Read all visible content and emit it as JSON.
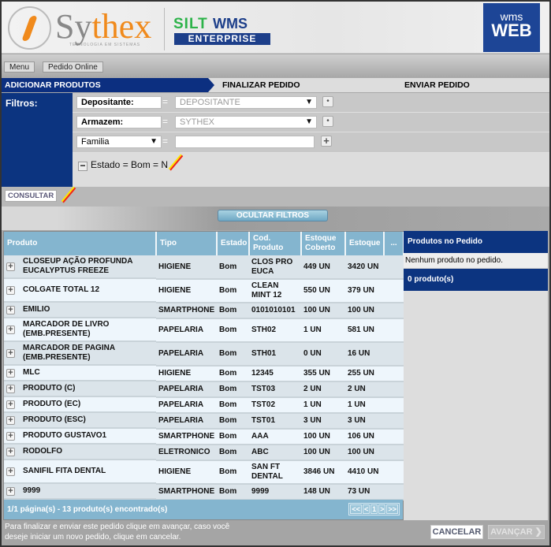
{
  "header": {
    "brand": "Sythex",
    "brand_sub": "TECNOLOGIA EM SISTEMAS",
    "product_a": "SILT",
    "product_b": "WMS",
    "product_c": "ENTERPRISE",
    "badge_a": "wms",
    "badge_b": "WEB"
  },
  "breadcrumb": [
    "Menu",
    "Pedido Online"
  ],
  "steps": [
    "ADICIONAR PRODUTOS",
    "FINALIZAR PEDIDO",
    "ENVIAR PEDIDO"
  ],
  "filters": {
    "label": "Filtros:",
    "rows": [
      {
        "field": "Depositante:",
        "op": "=",
        "value": "DEPOSITANTE"
      },
      {
        "field": "Armazem:",
        "op": "=",
        "value": "SYTHEX"
      },
      {
        "field": "Familia",
        "op": "=",
        "value": ""
      }
    ],
    "active": "Estado = Bom = N",
    "consultar": "CONSULTAR",
    "toggle": "OCULTAR FILTROS"
  },
  "table": {
    "columns": [
      "Produto",
      "Tipo",
      "Estado",
      "Cod. Produto",
      "Estoque Coberto",
      "Estoque",
      "..."
    ],
    "rows": [
      [
        "CLOSEUP AÇÃO PROFUNDA EUCALYPTUS FREEZE",
        "HIGIENE",
        "Bom",
        "CLOS PRO EUCA",
        "449 UN",
        "3420 UN"
      ],
      [
        "COLGATE TOTAL 12",
        "HIGIENE",
        "Bom",
        "CLEAN MINT 12",
        "550 UN",
        "379 UN"
      ],
      [
        "EMILIO",
        "SMARTPHONE",
        "Bom",
        "0101010101",
        "100 UN",
        "100 UN"
      ],
      [
        "MARCADOR DE LIVRO (EMB.PRESENTE)",
        "PAPELARIA",
        "Bom",
        "STH02",
        "1 UN",
        "581 UN"
      ],
      [
        "MARCADOR DE PAGINA (EMB.PRESENTE)",
        "PAPELARIA",
        "Bom",
        "STH01",
        "0 UN",
        "16 UN"
      ],
      [
        "MLC",
        "HIGIENE",
        "Bom",
        "12345",
        "355 UN",
        "255 UN"
      ],
      [
        "PRODUTO (C)",
        "PAPELARIA",
        "Bom",
        "TST03",
        "2 UN",
        "2 UN"
      ],
      [
        "PRODUTO (EC)",
        "PAPELARIA",
        "Bom",
        "TST02",
        "1 UN",
        "1 UN"
      ],
      [
        "PRODUTO (ESC)",
        "PAPELARIA",
        "Bom",
        "TST01",
        "3 UN",
        "3 UN"
      ],
      [
        "PRODUTO GUSTAVO1",
        "SMARTPHONE",
        "Bom",
        "AAA",
        "100 UN",
        "106 UN"
      ],
      [
        "RODOLFO",
        "ELETRONICO",
        "Bom",
        "ABC",
        "100 UN",
        "100 UN"
      ],
      [
        "SANIFIL FITA DENTAL",
        "HIGIENE",
        "Bom",
        "SAN FT DENTAL",
        "3846 UN",
        "4410 UN"
      ],
      [
        "9999",
        "SMARTPHONE",
        "Bom",
        "9999",
        "148 UN",
        "73 UN"
      ]
    ],
    "tall_rows": [
      0,
      1,
      3,
      4,
      11
    ],
    "pager_text": "1/1 página(s) - 13 produto(s) encontrado(s)",
    "pager_buttons": [
      "<<",
      "<",
      "1",
      ">",
      ">>"
    ]
  },
  "side": {
    "title": "Produtos no Pedido",
    "empty": "Nenhum produto no pedido.",
    "count": "0 produto(s)"
  },
  "footer": {
    "text": "Para finalizar e enviar este pedido clique em avançar, caso você deseje iniciar um novo pedido, clique em cancelar.",
    "cancel": "CANCELAR",
    "next": "AVANÇAR ❯"
  }
}
